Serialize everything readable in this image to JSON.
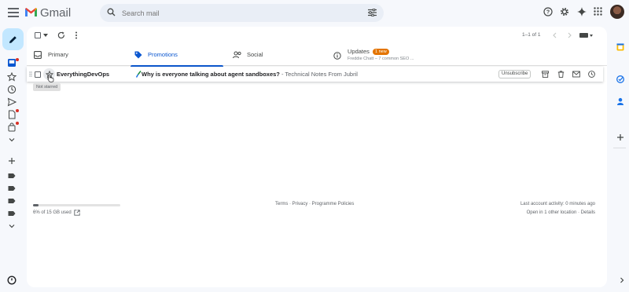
{
  "app": {
    "name": "Gmail"
  },
  "search": {
    "placeholder": "Search mail"
  },
  "toolbar": {
    "pagination": "1–1 of 1"
  },
  "tabs": [
    {
      "label": "Primary"
    },
    {
      "label": "Promotions"
    },
    {
      "label": "Social"
    },
    {
      "label": "Updates",
      "badge": "1 new",
      "subtitle": "Freddie Chatt – 7 common SEO ..."
    }
  ],
  "email": {
    "sender": "EverythingDevOps",
    "subject": "Why is everyone talking about agent sandboxes?",
    "separator": " - ",
    "snippet": "Technical Notes From Jubril",
    "unsubscribe": "Unsubscribe",
    "star_tooltip": "Not starred"
  },
  "footer": {
    "storage": "6% of 15 GB used",
    "storage_fraction": 0.06,
    "links": "Terms · Privacy · Programme Policies",
    "activity": "Last account activity: 0 minutes ago",
    "location": "Open in 1 other location · Details"
  },
  "colors": {
    "accent": "#0b57d0",
    "compose": "#c2e7ff",
    "badge": "#e37400",
    "background": "#f6f8fc"
  }
}
